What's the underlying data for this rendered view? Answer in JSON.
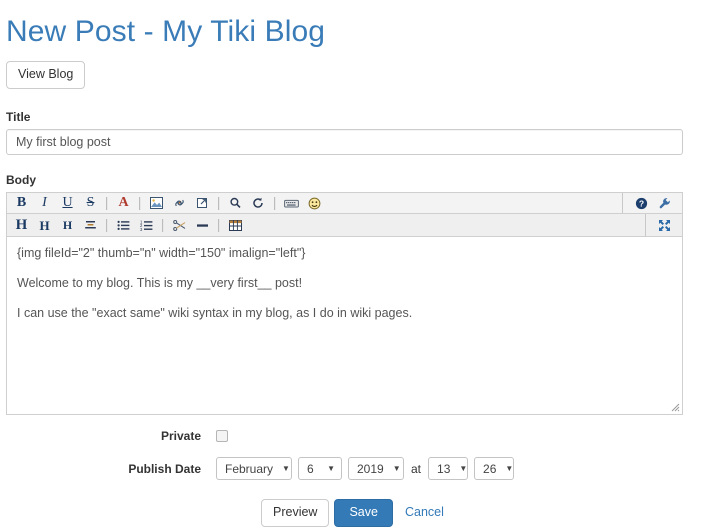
{
  "header": {
    "title": "New Post - My Tiki Blog",
    "view_blog_label": "View Blog"
  },
  "form": {
    "title_label": "Title",
    "title_value": "My first blog post",
    "title_placeholder": "",
    "body_label": "Body",
    "body_lines": [
      "{img fileId=\"2\" thumb=\"n\" width=\"150\" imalign=\"left\"}",
      "Welcome to my blog. This is my __very first__ post!",
      "I can use the \"exact same\" wiki syntax in my blog, as I do in wiki pages."
    ],
    "private_label": "Private",
    "private_checked": false,
    "publish_date_label": "Publish Date",
    "at_label": "at",
    "date": {
      "month": "February",
      "day": "6",
      "year": "2019",
      "hour": "13",
      "minute": "26"
    }
  },
  "toolbar": {
    "row1": [
      {
        "name": "bold-icon",
        "glyph": "B",
        "style": "b-bold"
      },
      {
        "name": "italic-icon",
        "glyph": "I",
        "style": "b-ital"
      },
      {
        "name": "underline-icon",
        "glyph": "U",
        "style": "b-under"
      },
      {
        "name": "strikethrough-icon",
        "glyph": "S",
        "style": "b-strike"
      },
      {
        "name": "text-color-icon",
        "glyph": "A",
        "style": "b-color"
      },
      {
        "name": "insert-image-icon",
        "glyph": "",
        "style": ""
      },
      {
        "name": "insert-link-icon",
        "glyph": "",
        "style": ""
      },
      {
        "name": "external-link-icon",
        "glyph": "",
        "style": ""
      },
      {
        "name": "search-icon",
        "glyph": "",
        "style": ""
      },
      {
        "name": "replace-icon",
        "glyph": "",
        "style": ""
      },
      {
        "name": "keyboard-icon",
        "glyph": "",
        "style": ""
      },
      {
        "name": "smiley-icon",
        "glyph": "",
        "style": ""
      }
    ],
    "row1_right": [
      {
        "name": "help-icon",
        "glyph": ""
      },
      {
        "name": "wrench-settings-icon",
        "glyph": ""
      }
    ],
    "row2": [
      {
        "name": "heading1-icon",
        "glyph": "H",
        "style": "b-h1"
      },
      {
        "name": "heading2-icon",
        "glyph": "H",
        "style": "b-h2"
      },
      {
        "name": "heading3-icon",
        "glyph": "H",
        "style": "b-h3"
      },
      {
        "name": "align-center-icon",
        "glyph": "",
        "style": ""
      },
      {
        "name": "bullet-list-icon",
        "glyph": "",
        "style": ""
      },
      {
        "name": "numbered-list-icon",
        "glyph": "",
        "style": ""
      },
      {
        "name": "cut-scissors-icon",
        "glyph": "",
        "style": ""
      },
      {
        "name": "horizontal-rule-icon",
        "glyph": "",
        "style": ""
      },
      {
        "name": "insert-table-icon",
        "glyph": "",
        "style": ""
      }
    ],
    "row2_right": [
      {
        "name": "fullscreen-icon",
        "glyph": ""
      }
    ]
  },
  "actions": {
    "preview_label": "Preview",
    "save_label": "Save",
    "cancel_label": "Cancel"
  },
  "colors": {
    "heading": "#3a7cb8",
    "primary": "#337ab7",
    "link": "#337ab7",
    "toolbar_bg": "#f3f3f3",
    "border": "#cccccc",
    "text": "#333333"
  }
}
